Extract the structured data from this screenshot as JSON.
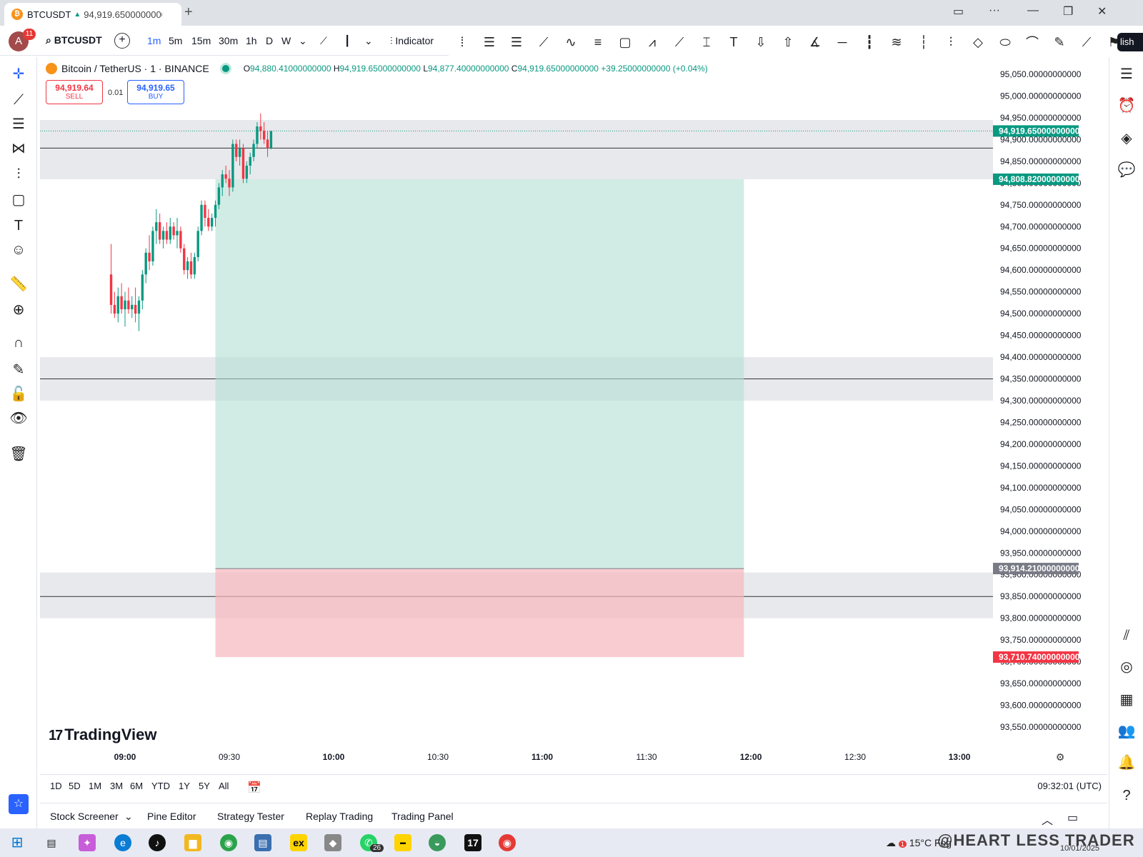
{
  "browser": {
    "tab_symbol": "BTCUSDT",
    "tab_arrow": "▲",
    "tab_price": "94,919.65000000000"
  },
  "header": {
    "notification_count": "11",
    "avatar_initial": "A",
    "symbol": "BTCUSDT",
    "timeframes": [
      "1m",
      "5m",
      "15m",
      "30m",
      "1h",
      "D",
      "W"
    ],
    "active_timeframe": "1m",
    "indicators_label": "Indicator",
    "publish_label": "lish"
  },
  "legend": {
    "title": "Bitcoin / TetherUS · 1 · BINANCE",
    "o_label": "O",
    "o": "94,880.41000000000",
    "h_label": "H",
    "h": "94,919.65000000000",
    "l_label": "L",
    "l": "94,877.40000000000",
    "c_label": "C",
    "c": "94,919.65000000000",
    "change": "+39.25000000000 (+0.04%)"
  },
  "trade": {
    "sell_price": "94,919.64",
    "sell_label": "SELL",
    "spread": "0.01",
    "buy_price": "94,919.65",
    "buy_label": "BUY"
  },
  "price_axis": {
    "ticks": [
      "95,050.00000000000",
      "95,000.00000000000",
      "94,950.00000000000",
      "94,900.00000000000",
      "94,850.00000000000",
      "94,800.00000000000",
      "94,750.00000000000",
      "94,700.00000000000",
      "94,650.00000000000",
      "94,600.00000000000",
      "94,550.00000000000",
      "94,500.00000000000",
      "94,450.00000000000",
      "94,400.00000000000",
      "94,350.00000000000",
      "94,300.00000000000",
      "94,250.00000000000",
      "94,200.00000000000",
      "94,150.00000000000",
      "94,100.00000000000",
      "94,050.00000000000",
      "94,000.00000000000",
      "93,950.00000000000",
      "93,900.00000000000",
      "93,850.00000000000",
      "93,800.00000000000",
      "93,750.00000000000",
      "93,700.00000000000",
      "93,650.00000000000",
      "93,600.00000000000",
      "93,550.00000000000"
    ],
    "current_price": "94,919.65000000000",
    "target_price": "94,808.82000000000",
    "entry_price": "93,914.21000000000",
    "stop_price": "93,710.74000000000",
    "current_color": "#089981",
    "target_color": "#089981",
    "entry_color": "#787b86",
    "stop_color": "#f23645"
  },
  "time_axis": {
    "labels": [
      "09:00",
      "09:30",
      "10:00",
      "10:30",
      "11:00",
      "11:30",
      "12:00",
      "12:30",
      "13:00"
    ]
  },
  "position": {
    "entry": 93914.21,
    "target": 94808.82,
    "stop": 93710.74,
    "start_time": "09:26",
    "end_time": "11:58",
    "profit_color": "#b2dfd4",
    "loss_color": "#f7b6bd"
  },
  "zones": [
    {
      "from": 94808.82,
      "to": 94945.0,
      "line": 94880.41
    },
    {
      "from": 94300.0,
      "to": 94400.0,
      "line": 94350.0
    },
    {
      "from": 93800.0,
      "to": 93905.0,
      "line": 93850.0
    }
  ],
  "chart_data": {
    "type": "candlestick",
    "start_time": "08:56",
    "interval_minutes": 1,
    "up_color": "#089981",
    "down_color": "#f23645",
    "candles": [
      [
        94590,
        94660,
        94500,
        94520
      ],
      [
        94520,
        94550,
        94490,
        94500
      ],
      [
        94500,
        94560,
        94480,
        94540
      ],
      [
        94540,
        94570,
        94500,
        94510
      ],
      [
        94510,
        94550,
        94470,
        94530
      ],
      [
        94530,
        94560,
        94500,
        94510
      ],
      [
        94510,
        94540,
        94490,
        94520
      ],
      [
        94520,
        94560,
        94480,
        94500
      ],
      [
        94500,
        94540,
        94460,
        94530
      ],
      [
        94530,
        94600,
        94510,
        94590
      ],
      [
        94590,
        94650,
        94570,
        94640
      ],
      [
        94640,
        94680,
        94600,
        94620
      ],
      [
        94620,
        94700,
        94610,
        94690
      ],
      [
        94690,
        94740,
        94660,
        94710
      ],
      [
        94710,
        94730,
        94660,
        94670
      ],
      [
        94670,
        94700,
        94650,
        94690
      ],
      [
        94690,
        94710,
        94660,
        94670
      ],
      [
        94670,
        94720,
        94660,
        94700
      ],
      [
        94700,
        94710,
        94670,
        94680
      ],
      [
        94680,
        94720,
        94650,
        94690
      ],
      [
        94690,
        94700,
        94640,
        94650
      ],
      [
        94650,
        94660,
        94590,
        94600
      ],
      [
        94600,
        94630,
        94580,
        94620
      ],
      [
        94620,
        94640,
        94580,
        94590
      ],
      [
        94590,
        94640,
        94580,
        94630
      ],
      [
        94630,
        94700,
        94620,
        94690
      ],
      [
        94690,
        94760,
        94680,
        94750
      ],
      [
        94750,
        94760,
        94700,
        94720
      ],
      [
        94720,
        94740,
        94690,
        94700
      ],
      [
        94700,
        94730,
        94690,
        94720
      ],
      [
        94720,
        94760,
        94700,
        94750
      ],
      [
        94750,
        94800,
        94740,
        94790
      ],
      [
        94790,
        94830,
        94770,
        94820
      ],
      [
        94820,
        94840,
        94800,
        94810
      ],
      [
        94810,
        94830,
        94770,
        94790
      ],
      [
        94790,
        94900,
        94780,
        94890
      ],
      [
        94890,
        94900,
        94850,
        94860
      ],
      [
        94860,
        94900,
        94840,
        94880
      ],
      [
        94880,
        94890,
        94800,
        94810
      ],
      [
        94810,
        94850,
        94800,
        94840
      ],
      [
        94840,
        94870,
        94820,
        94860
      ],
      [
        94860,
        94900,
        94850,
        94890
      ],
      [
        94890,
        94940,
        94880,
        94930
      ],
      [
        94930,
        94960,
        94900,
        94920
      ],
      [
        94920,
        94940,
        94890,
        94900
      ],
      [
        94900,
        94920,
        94860,
        94880
      ],
      [
        94880,
        94919.65,
        94877.4,
        94919.65
      ]
    ]
  },
  "bottom": {
    "periods": [
      "1D",
      "5D",
      "1M",
      "3M",
      "6M",
      "YTD",
      "1Y",
      "5Y",
      "All"
    ],
    "clock": "09:32:01 (UTC)",
    "logo": "TradingView"
  },
  "panels": [
    "Stock Screener",
    "Pine Editor",
    "Strategy Tester",
    "Replay Trading",
    "Trading Panel"
  ],
  "taskbar": {
    "temperature": "15°C",
    "weather": "Fog",
    "whatsapp_badge": "26",
    "weather_badge": "1",
    "watermark": "@HEART LESS TRADER",
    "date": "10/01/2025",
    "exness_label": "ex"
  }
}
